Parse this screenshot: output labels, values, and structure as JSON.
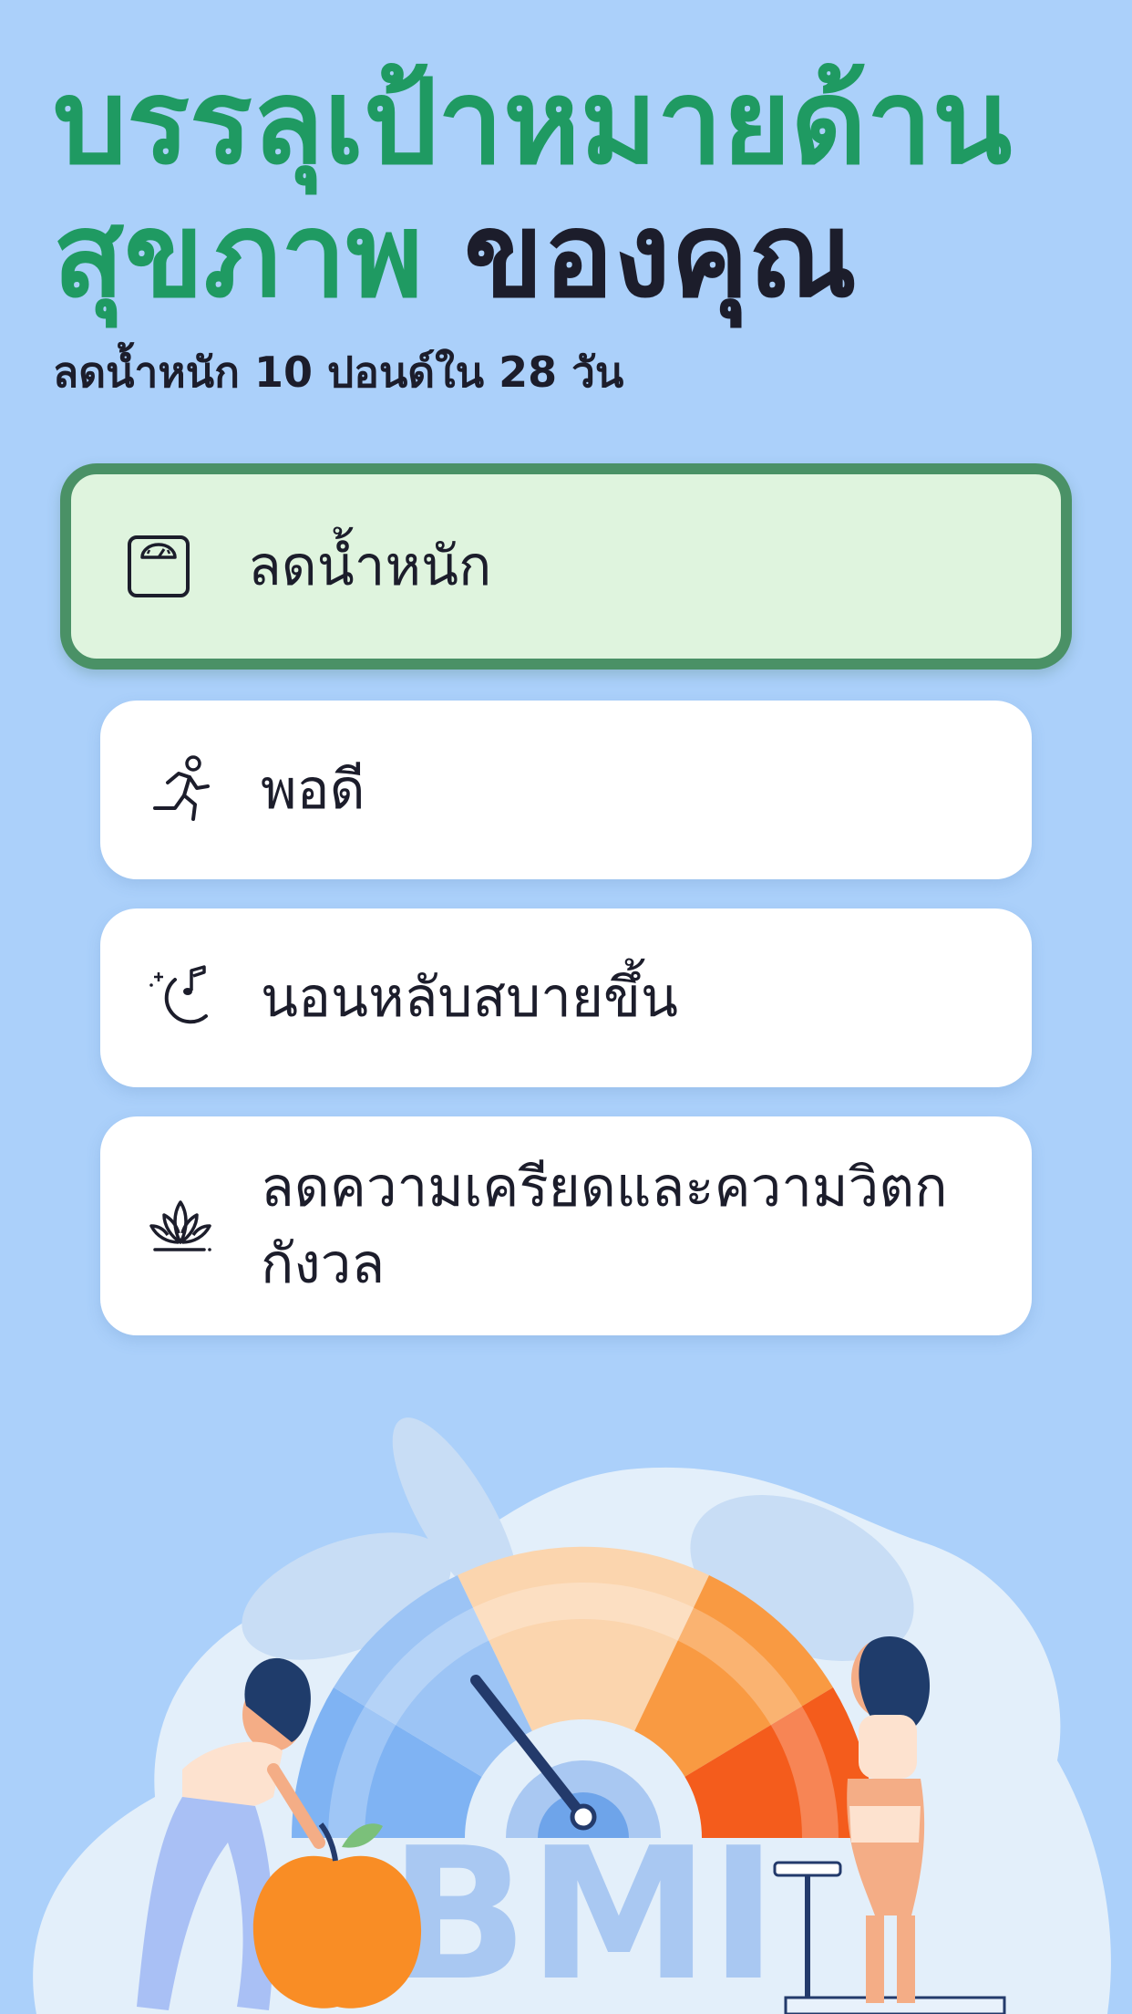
{
  "header": {
    "title_green": "บรรลุเป้าหมายด้านสุขภาพ",
    "title_dark": "ของคุณ",
    "subtitle": "ลดน้ำหนัก 10 ปอนด์ใน 28 วัน"
  },
  "goals": [
    {
      "label": "ลดน้ำหนัก",
      "icon": "scale-icon",
      "selected": true
    },
    {
      "label": "พอดี",
      "icon": "running-person-icon",
      "selected": false
    },
    {
      "label": "นอนหลับสบายขึ้น",
      "icon": "moon-music-icon",
      "selected": false
    },
    {
      "label": "ลดความเครียดและความวิตกกังวล",
      "icon": "lotus-icon",
      "selected": false
    }
  ],
  "illustration": {
    "bmi_text": "BMI"
  },
  "colors": {
    "background": "#abd0fa",
    "accent_green": "#1f9a62",
    "selected_border": "#4a9166",
    "selected_fill": "#dff4de",
    "text_dark": "#1c1d2b"
  }
}
